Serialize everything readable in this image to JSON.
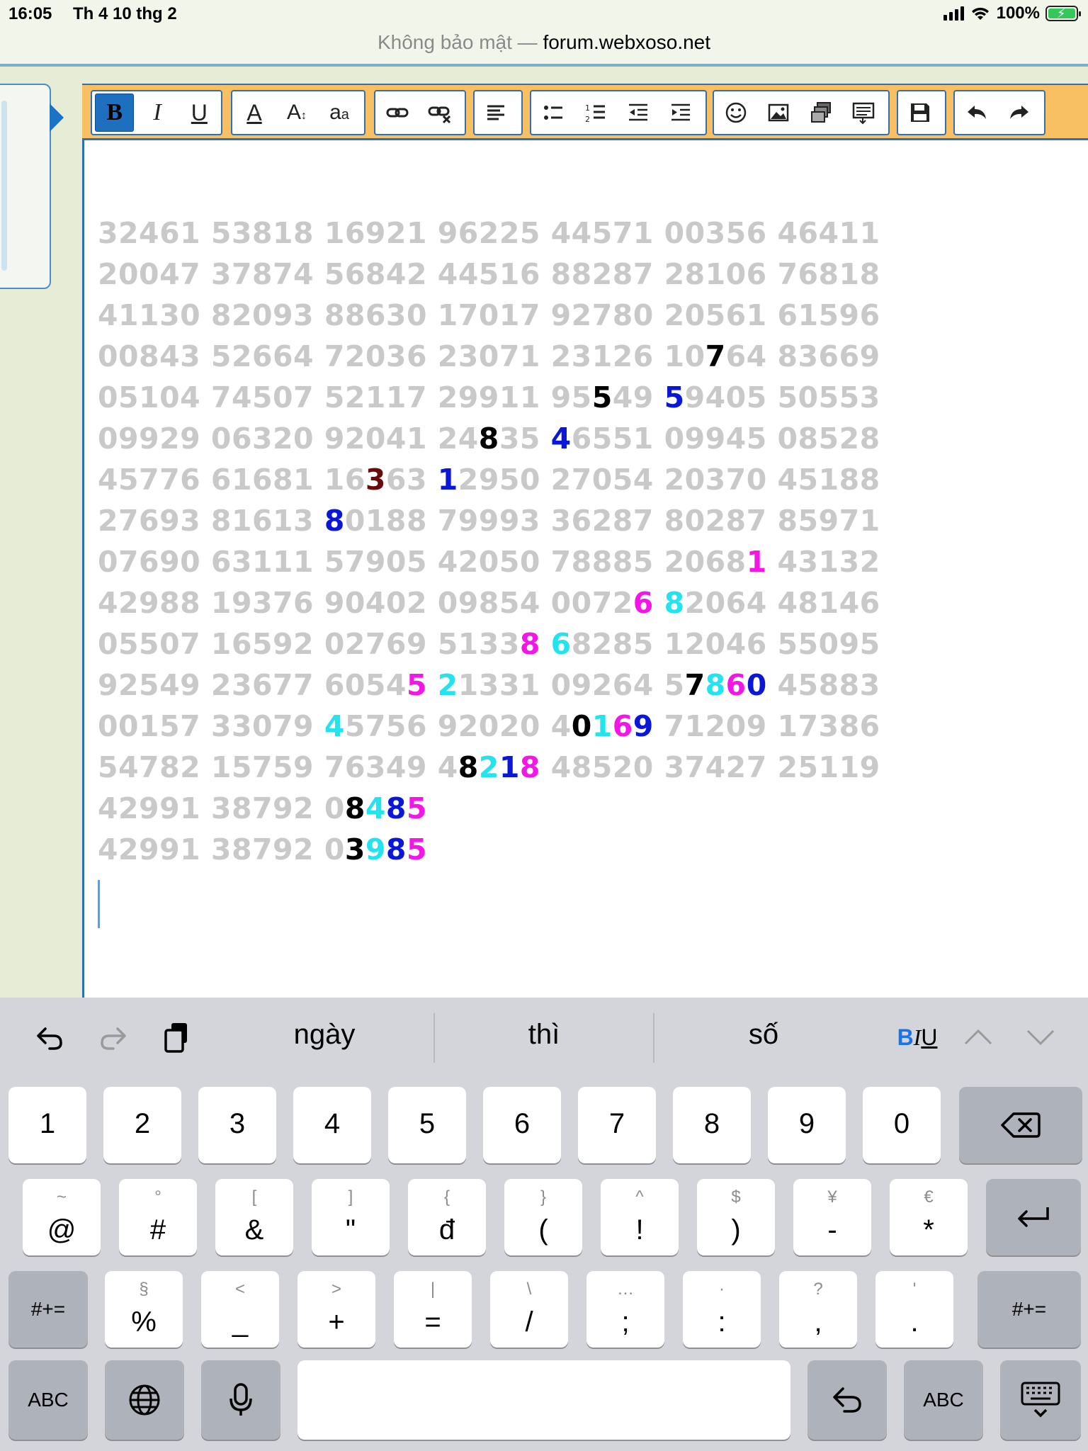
{
  "status": {
    "time": "16:05",
    "date": "Th 4 10 thg 2",
    "battery": "100%"
  },
  "url": {
    "security": "Không bảo mật —",
    "host": "forum.webxoso.net"
  },
  "toolbar": {
    "groups": [
      [
        "bold-icon",
        "italic-icon",
        "underline-icon"
      ],
      [
        "font-color-icon",
        "font-size-icon",
        "font-family-icon"
      ],
      [
        "link-icon",
        "unlink-icon"
      ],
      [
        "align-icon"
      ],
      [
        "bullet-list-icon",
        "numbered-list-icon",
        "outdent-icon",
        "indent-icon"
      ],
      [
        "smiley-icon",
        "image-icon",
        "media-icon",
        "quote-icon"
      ],
      [
        "save-icon"
      ],
      [
        "undo-icon",
        "redo-icon"
      ]
    ]
  },
  "colors": {
    "gray": "#c9c9c9",
    "black": "#000000",
    "blue": "#0a17d8",
    "magenta": "#f316e6",
    "cyan": "#22e3ee",
    "maroon": "#6b0a0a"
  },
  "editor_lines": [
    [
      [
        "g",
        "32461 53818 16921 96225 44571 00356 46411"
      ]
    ],
    [
      [
        "g",
        "20047 37874 56842 44516 88287 28106 76818"
      ]
    ],
    [
      [
        "g",
        "41130 82093 88630 17017 92780 20561 61596"
      ]
    ],
    [
      [
        "g",
        "00843 52664 72036 23071 23126 10"
      ],
      [
        "k",
        "7"
      ],
      [
        "g",
        "64 83669"
      ]
    ],
    [
      [
        "g",
        "05104 74507 52117 29911 95"
      ],
      [
        "k",
        "5"
      ],
      [
        "g",
        "49 "
      ],
      [
        "b",
        "5"
      ],
      [
        "g",
        "9405 50553"
      ]
    ],
    [
      [
        "g",
        "09929 06320 92041 24"
      ],
      [
        "k",
        "8"
      ],
      [
        "g",
        "35 "
      ],
      [
        "b",
        "4"
      ],
      [
        "g",
        "6551 09945 08528"
      ]
    ],
    [
      [
        "g",
        "45776 61681 16"
      ],
      [
        "r",
        "3"
      ],
      [
        "g",
        "63 "
      ],
      [
        "b",
        "1"
      ],
      [
        "g",
        "2950 27054 20370 45188"
      ]
    ],
    [
      [
        "g",
        "27693 81613 "
      ],
      [
        "b",
        "8"
      ],
      [
        "g",
        "0188 79993 36287 80287 85971"
      ]
    ],
    [
      [
        "g",
        "07690 63111 57905 42050 78885 2068"
      ],
      [
        "m",
        "1"
      ],
      [
        "g",
        " 43132"
      ]
    ],
    [
      [
        "g",
        "42988 19376 90402 09854 0072"
      ],
      [
        "m",
        "6"
      ],
      [
        "g",
        " "
      ],
      [
        "c",
        "8"
      ],
      [
        "g",
        "2064 48146"
      ]
    ],
    [
      [
        "g",
        "05507 16592 02769 5133"
      ],
      [
        "m",
        "8"
      ],
      [
        "g",
        " "
      ],
      [
        "c",
        "6"
      ],
      [
        "g",
        "8285 12046 55095"
      ]
    ],
    [
      [
        "g",
        "92549 23677 6054"
      ],
      [
        "m",
        "5"
      ],
      [
        "g",
        " "
      ],
      [
        "c",
        "2"
      ],
      [
        "g",
        "1331 09264 5"
      ],
      [
        "k",
        "7"
      ],
      [
        "c",
        "8"
      ],
      [
        "m",
        "6"
      ],
      [
        "b",
        "0"
      ],
      [
        "g",
        " 45883"
      ]
    ],
    [
      [
        "g",
        "00157 33079 "
      ],
      [
        "c",
        "4"
      ],
      [
        "g",
        "5756 92020 4"
      ],
      [
        "k",
        "0"
      ],
      [
        "c",
        "1"
      ],
      [
        "m",
        "6"
      ],
      [
        "b",
        "9"
      ],
      [
        "g",
        " 71209 17386"
      ]
    ],
    [
      [
        "g",
        "54782 15759 76349 4"
      ],
      [
        "k",
        "8"
      ],
      [
        "c",
        "2"
      ],
      [
        "b",
        "1"
      ],
      [
        "m",
        "8"
      ],
      [
        "g",
        " 48520 37427 25119"
      ]
    ],
    [
      [
        "g",
        "42991 38792 0"
      ],
      [
        "k",
        "8"
      ],
      [
        "c",
        "4"
      ],
      [
        "b",
        "8"
      ],
      [
        "m",
        "5"
      ]
    ],
    [
      [
        "g",
        "42991 38792 0"
      ],
      [
        "k",
        "3"
      ],
      [
        "c",
        "9"
      ],
      [
        "b",
        "8"
      ],
      [
        "m",
        "5"
      ]
    ]
  ],
  "keyboard": {
    "suggestions": [
      "ngày",
      "thì",
      "số"
    ],
    "biu": [
      "B",
      "I",
      "U"
    ],
    "row1": [
      "1",
      "2",
      "3",
      "4",
      "5",
      "6",
      "7",
      "8",
      "9",
      "0"
    ],
    "row2": [
      {
        "alt": "~",
        "main": "@"
      },
      {
        "alt": "°",
        "main": "#"
      },
      {
        "alt": "[",
        "main": "&"
      },
      {
        "alt": "]",
        "main": "\""
      },
      {
        "alt": "{",
        "main": "đ"
      },
      {
        "alt": "}",
        "main": "("
      },
      {
        "alt": "^",
        "main": "!"
      },
      {
        "alt": "$",
        "main": ")"
      },
      {
        "alt": "¥",
        "main": "-"
      },
      {
        "alt": "€",
        "main": "*"
      }
    ],
    "row3_left": "#+=",
    "row3": [
      {
        "alt": "§",
        "main": "%"
      },
      {
        "alt": "<",
        "main": "_"
      },
      {
        "alt": ">",
        "main": "+"
      },
      {
        "alt": "|",
        "main": "="
      },
      {
        "alt": "\\",
        "main": "/"
      },
      {
        "alt": "…",
        "main": ";"
      },
      {
        "alt": "·",
        "main": ":"
      },
      {
        "alt": "?",
        "main": ","
      },
      {
        "alt": "'",
        "main": "."
      }
    ],
    "row3_right": "#+=",
    "abc_left": "ABC",
    "abc_right": "ABC"
  }
}
